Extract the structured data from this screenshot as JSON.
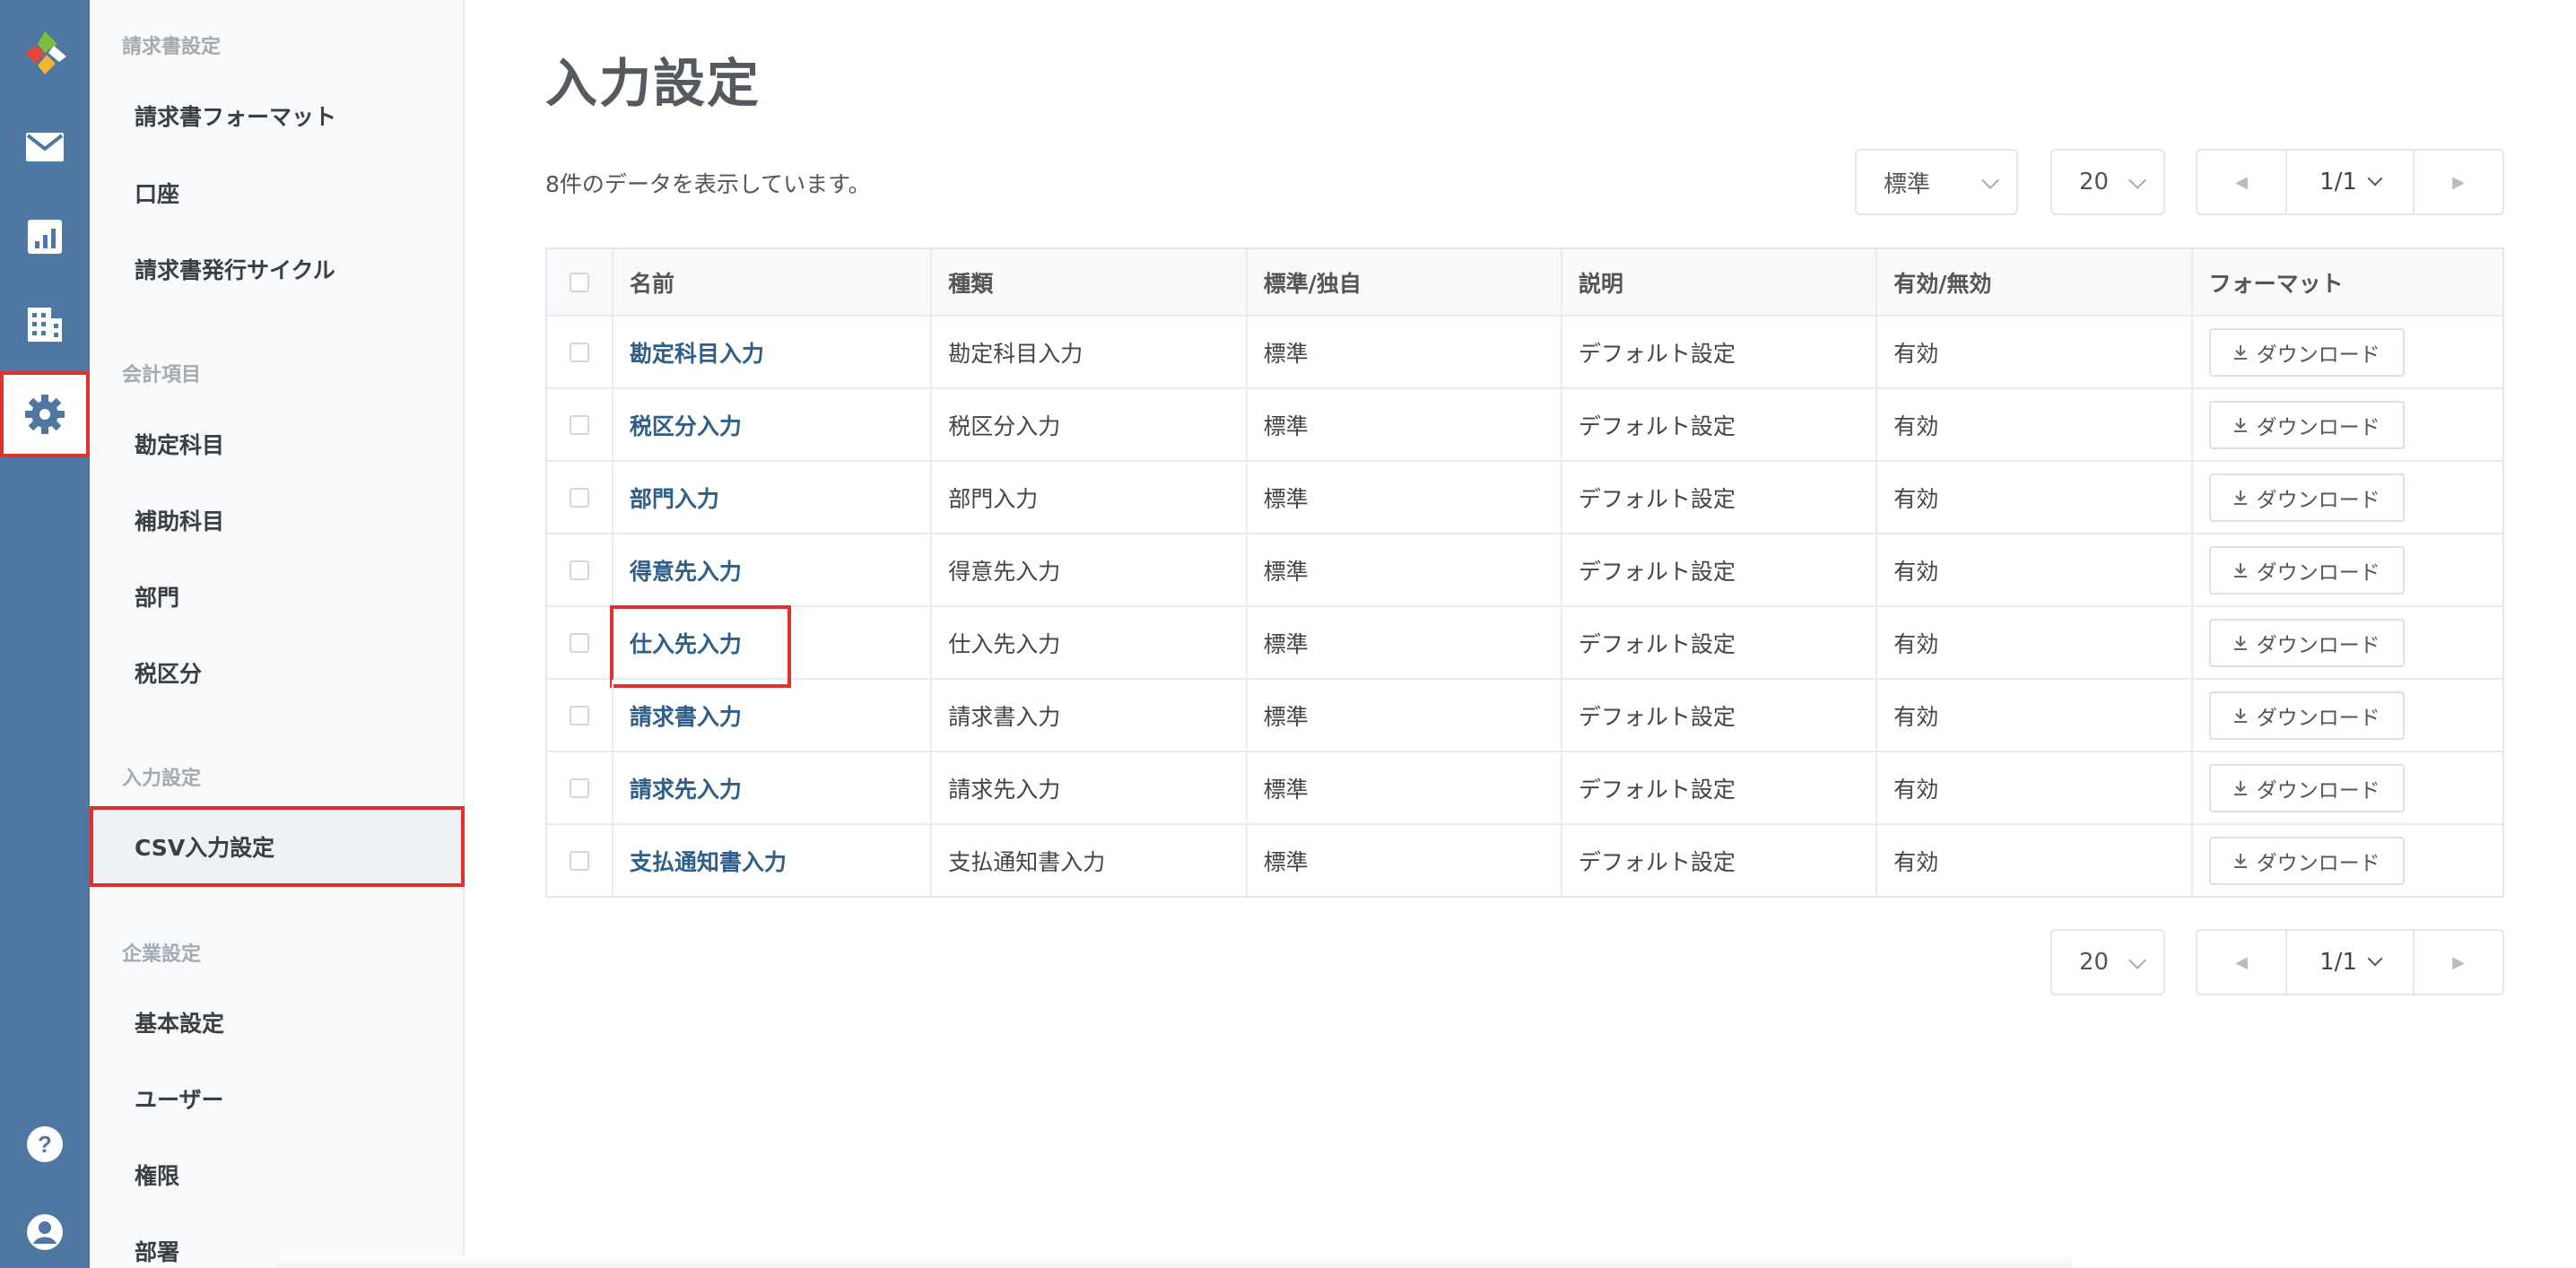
{
  "sidebar_rail": {
    "items": [
      {
        "name": "mail-icon"
      },
      {
        "name": "chart-icon"
      },
      {
        "name": "building-icon"
      },
      {
        "name": "gear-icon",
        "active": true
      },
      {
        "name": "help-icon"
      },
      {
        "name": "user-icon"
      }
    ]
  },
  "submenu": {
    "groups": [
      {
        "title": "請求書設定",
        "items": [
          "請求書フォーマット",
          "口座",
          "請求書発行サイクル"
        ]
      },
      {
        "title": "会計項目",
        "items": [
          "勘定科目",
          "補助科目",
          "部門",
          "税区分"
        ]
      },
      {
        "title": "入力設定",
        "items": [
          "CSV入力設定"
        ]
      },
      {
        "title": "企業設定",
        "items": [
          "基本設定",
          "ユーザー",
          "権限",
          "部署"
        ]
      }
    ],
    "active_item": "CSV入力設定"
  },
  "main": {
    "title": "入力設定",
    "result_count": "8件のデータを表示しています。",
    "filter": {
      "selected": "標準"
    },
    "per_page": {
      "selected": "20"
    },
    "pagination": {
      "current": "1/1"
    },
    "bottom_per_page": {
      "selected": "20"
    },
    "bottom_pagination": {
      "current": "1/1"
    }
  },
  "table": {
    "headers": [
      "名前",
      "種類",
      "標準/独自",
      "説明",
      "有効/無効",
      "フォーマット"
    ],
    "download_label": "ダウンロード",
    "rows": [
      {
        "name": "勘定科目入力",
        "type": "勘定科目入力",
        "kind": "標準",
        "desc": "デフォルト設定",
        "status": "有効"
      },
      {
        "name": "税区分入力",
        "type": "税区分入力",
        "kind": "標準",
        "desc": "デフォルト設定",
        "status": "有効"
      },
      {
        "name": "部門入力",
        "type": "部門入力",
        "kind": "標準",
        "desc": "デフォルト設定",
        "status": "有効"
      },
      {
        "name": "得意先入力",
        "type": "得意先入力",
        "kind": "標準",
        "desc": "デフォルト設定",
        "status": "有効"
      },
      {
        "name": "仕入先入力",
        "type": "仕入先入力",
        "kind": "標準",
        "desc": "デフォルト設定",
        "status": "有効",
        "highlighted": true
      },
      {
        "name": "請求書入力",
        "type": "請求書入力",
        "kind": "標準",
        "desc": "デフォルト設定",
        "status": "有効"
      },
      {
        "name": "請求先入力",
        "type": "請求先入力",
        "kind": "標準",
        "desc": "デフォルト設定",
        "status": "有効"
      },
      {
        "name": "支払通知書入力",
        "type": "支払通知書入力",
        "kind": "標準",
        "desc": "デフォルト設定",
        "status": "有効"
      }
    ]
  },
  "colors": {
    "rail": "#4e77a1",
    "link": "#2f5f88",
    "highlight": "#e2302a"
  }
}
